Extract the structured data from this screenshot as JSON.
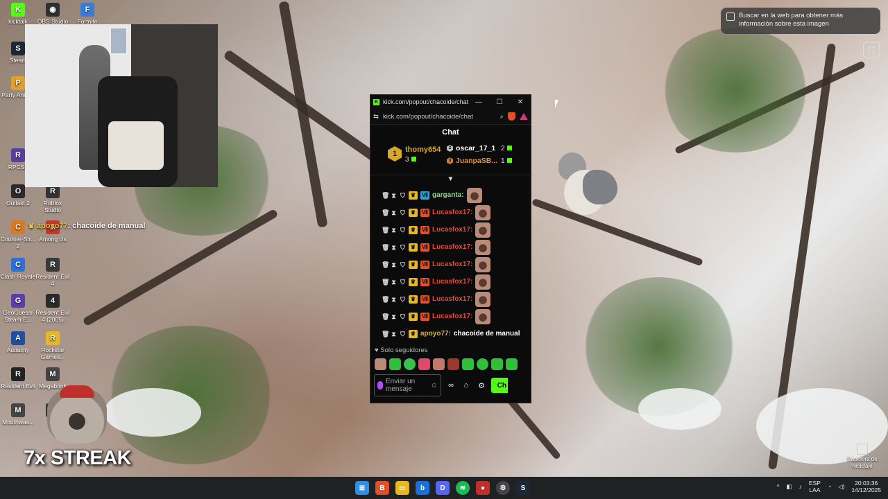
{
  "desktop": {
    "icons": [
      {
        "label": "kicktalk",
        "color": "#53fc18",
        "glyph": "K"
      },
      {
        "label": "OBS Studio",
        "color": "#303030",
        "glyph": "◉"
      },
      {
        "label": "Fortnite",
        "color": "#3a7bd5",
        "glyph": "F"
      },
      {
        "label": "Steam",
        "color": "#1b2838",
        "glyph": "S"
      },
      {
        "label": "Party Animal",
        "color": "#e0a030",
        "glyph": "P"
      },
      {
        "label": "RPCS3",
        "color": "#5a3fa0",
        "glyph": "R"
      },
      {
        "label": "Outlast 2",
        "color": "#2a2a2a",
        "glyph": "O"
      },
      {
        "label": "Roblox Studio",
        "color": "#333",
        "glyph": "R"
      },
      {
        "label": "Counter-Str... 2",
        "color": "#d87b20",
        "glyph": "C"
      },
      {
        "label": "Among Us",
        "color": "#c0392b",
        "glyph": "A"
      },
      {
        "label": "Clash Royale",
        "color": "#2e6fd8",
        "glyph": "C"
      },
      {
        "label": "Resident Evil 4",
        "color": "#3a3a3a",
        "glyph": "R"
      },
      {
        "label": "GeoGuessr Steam E...",
        "color": "#5b3fa8",
        "glyph": "G"
      },
      {
        "label": "Resident Evil 4 (2005)",
        "color": "#2a2a2a",
        "glyph": "4"
      },
      {
        "label": "Audacity",
        "color": "#1f4fa0",
        "glyph": "A"
      },
      {
        "label": "Rockstar Games...",
        "color": "#e8b820",
        "glyph": "R"
      },
      {
        "label": "Resident Evil",
        "color": "#222",
        "glyph": "R"
      },
      {
        "label": "Megabonk",
        "color": "#444",
        "glyph": "M"
      },
      {
        "label": "Mouthwas...",
        "color": "#444",
        "glyph": "M"
      },
      {
        "label": "Di",
        "color": "#333",
        "glyph": "D"
      }
    ],
    "overlay_chat_line": {
      "user": "apoyo77",
      "text": "chacoide de manual"
    },
    "streak": "7x STREAK",
    "recycle_bin": "Papelera de reciclaje"
  },
  "lens": {
    "text": "Buscar en la web para obtener más información sobre esta imagen"
  },
  "window": {
    "title": "kick.com/popout/chacoide/chat -...",
    "url": "kick.com/popout/chacoide/chat",
    "chat_heading": "Chat",
    "leaderboard": {
      "first": {
        "rank": "1",
        "name": "thomy654",
        "count": "3"
      },
      "second": {
        "rank": "2",
        "name": "oscar_17_1",
        "count": "2"
      },
      "third": {
        "rank": "3",
        "name": "JuanpaSB...",
        "count": "1"
      }
    },
    "messages": [
      {
        "user": "garganta:",
        "color": "#7ee07a",
        "text": ""
      },
      {
        "user": "Lucasfox17:",
        "color": "#e04a3a",
        "text": ""
      },
      {
        "user": "Lucasfox17:",
        "color": "#e04a3a",
        "text": ""
      },
      {
        "user": "Lucasfox17:",
        "color": "#e04a3a",
        "text": ""
      },
      {
        "user": "Lucasfox17:",
        "color": "#e04a3a",
        "text": ""
      },
      {
        "user": "Lucasfox17:",
        "color": "#e04a3a",
        "text": ""
      },
      {
        "user": "Lucasfox17:",
        "color": "#e04a3a",
        "text": ""
      },
      {
        "user": "Lucasfox17:",
        "color": "#e04a3a",
        "text": ""
      },
      {
        "user": "apoyo77:",
        "color": "#d8b43a",
        "text": "chacoide de manual"
      }
    ],
    "followers_only": "Solo seguidores",
    "input_placeholder": "Enviar un mensaje",
    "send_label": "Ch"
  },
  "taskbar": {
    "lang_top": "ESP",
    "lang_bottom": "LAA",
    "time": "20:03:36",
    "date": "14/12/2025"
  },
  "colors": {
    "kick_green": "#53fc18",
    "gold": "#d8a82a"
  }
}
